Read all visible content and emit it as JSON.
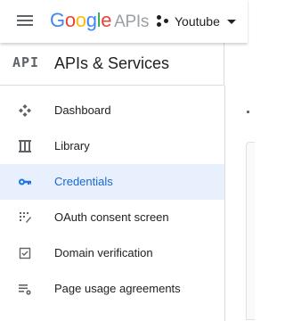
{
  "header": {
    "brand": {
      "google_letters": [
        {
          "ch": "G",
          "color": "#4285F4"
        },
        {
          "ch": "o",
          "color": "#EA4335"
        },
        {
          "ch": "o",
          "color": "#FBBC05"
        },
        {
          "ch": "g",
          "color": "#4285F4"
        },
        {
          "ch": "l",
          "color": "#34A853"
        },
        {
          "ch": "e",
          "color": "#EA4335"
        }
      ],
      "product": "APIs"
    },
    "project": "Youtube"
  },
  "sidebar": {
    "badge": "API",
    "title": "APIs & Services",
    "items": [
      {
        "label": "Dashboard",
        "icon": "dashboard-icon",
        "active": false
      },
      {
        "label": "Library",
        "icon": "library-icon",
        "active": false
      },
      {
        "label": "Credentials",
        "icon": "key-icon",
        "active": true
      },
      {
        "label": "OAuth consent screen",
        "icon": "consent-screen-icon",
        "active": false
      },
      {
        "label": "Domain verification",
        "icon": "checkbox-icon",
        "active": false
      },
      {
        "label": "Page usage agreements",
        "icon": "settings-list-icon",
        "active": false
      }
    ]
  },
  "colors": {
    "active_bg": "#e8f0fe",
    "active_text": "#1967d2",
    "icon_gray": "#5f6368"
  }
}
